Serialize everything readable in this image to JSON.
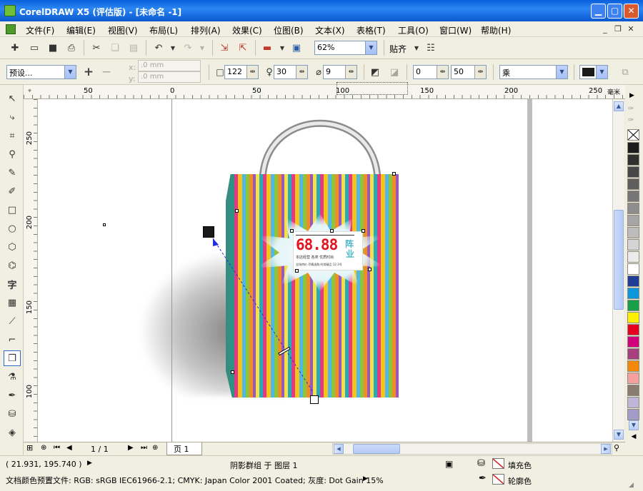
{
  "window": {
    "title": "CorelDRAW X5 (评估版) - [未命名 -1]"
  },
  "menu": [
    "文件(F)",
    "编辑(E)",
    "视图(V)",
    "布局(L)",
    "排列(A)",
    "效果(C)",
    "位图(B)",
    "文本(X)",
    "表格(T)",
    "工具(O)",
    "窗口(W)",
    "帮助(H)"
  ],
  "toolbar": {
    "zoom_value": "62%",
    "snap_label": "贴齐"
  },
  "property_bar": {
    "preset_value": "预设...",
    "x_label": "x:",
    "x_value": ".0 mm",
    "y_label": "y:",
    "y_value": ".0 mm",
    "opacity_value": "122",
    "feather_value": "30",
    "angle_value": "9",
    "stretch_value": "0",
    "fade_value": "50",
    "blend_mode_value": "乘"
  },
  "ruler": {
    "h_ticks": [
      "50",
      "0",
      "50",
      "100",
      "150",
      "200",
      "250"
    ],
    "h_unit": "毫米",
    "v_ticks": [
      "250",
      "200",
      "150",
      "100"
    ]
  },
  "bag": {
    "price_text": "68.88",
    "side_text_1": "阵",
    "side_text_2": "业",
    "fine_print_1": "本店经营 各类 优质时尚",
    "fine_print_2": "全场特价 尽情选购 时尚精品 12.3号"
  },
  "palette_colors": [
    "#1C1C1C",
    "#303030",
    "#474747",
    "#5E5E5E",
    "#767676",
    "#8D8D8D",
    "#A5A5A5",
    "#BCBCBC",
    "#D4D4D4",
    "#EBEBEB",
    "#FFFFFF",
    "#1F3C96",
    "#0C96DC",
    "#17A047",
    "#FFEF00",
    "#E6001F",
    "#D1007B",
    "#A6407F",
    "#F3870B",
    "#F5A09E",
    "#8A7D6F",
    "#BFB5D8",
    "#A29AC9"
  ],
  "navbar": {
    "page_count": "1 / 1",
    "page_tab": "页 1"
  },
  "status": {
    "coords": "( 21.931, 195.740 )",
    "selection": "阴影群组 于 图层 1",
    "fill_label": "填充色",
    "outline_label": "轮廓色",
    "color_profile": "文档颜色预置文件: RGB: sRGB IEC61966-2.1; CMYK: Japan Color 2001 Coated; 灰度: Dot Gain 15%"
  }
}
